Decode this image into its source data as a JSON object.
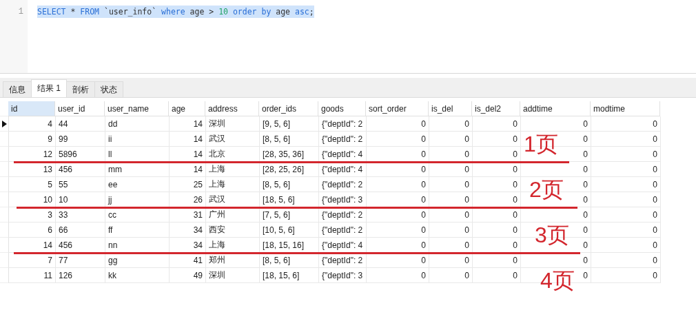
{
  "editor": {
    "lines": [
      {
        "number": "1",
        "selected": true,
        "tokens": [
          {
            "text": "SELECT",
            "kind": "keyword"
          },
          {
            "text": " * ",
            "kind": "plain"
          },
          {
            "text": "FROM",
            "kind": "keyword"
          },
          {
            "text": " `user_info` ",
            "kind": "plain"
          },
          {
            "text": "where",
            "kind": "keyword"
          },
          {
            "text": " age > ",
            "kind": "plain"
          },
          {
            "text": "10",
            "kind": "number"
          },
          {
            "text": " order",
            "kind": "keyword"
          },
          {
            "text": " by",
            "kind": "keyword"
          },
          {
            "text": " age ",
            "kind": "plain"
          },
          {
            "text": "asc",
            "kind": "keyword"
          },
          {
            "text": ";",
            "kind": "plain"
          }
        ]
      }
    ]
  },
  "tabs": [
    {
      "label": "信息",
      "selected": false
    },
    {
      "label": "结果 1",
      "selected": true
    },
    {
      "label": "剖析",
      "selected": false
    },
    {
      "label": "状态",
      "selected": false
    }
  ],
  "table": {
    "columns": [
      {
        "label": "id",
        "kind": "number",
        "selected": true
      },
      {
        "label": "user_id",
        "kind": "text",
        "selected": false
      },
      {
        "label": "user_name",
        "kind": "text",
        "selected": false
      },
      {
        "label": "age",
        "kind": "number",
        "selected": false
      },
      {
        "label": "address",
        "kind": "text",
        "selected": false
      },
      {
        "label": "order_ids",
        "kind": "text",
        "selected": false
      },
      {
        "label": "goods",
        "kind": "text",
        "selected": false
      },
      {
        "label": "sort_order",
        "kind": "number",
        "selected": false
      },
      {
        "label": "is_del",
        "kind": "number",
        "selected": false
      },
      {
        "label": "is_del2",
        "kind": "number",
        "selected": false
      },
      {
        "label": "addtime",
        "kind": "number",
        "selected": false
      },
      {
        "label": "modtime",
        "kind": "number",
        "selected": false
      }
    ],
    "rows": [
      {
        "selected": true,
        "cells": [
          "4",
          "44",
          "dd",
          "14",
          "深圳",
          "[9, 5, 6]",
          "{\"deptId\": 2",
          "0",
          "0",
          "0",
          "0",
          "0"
        ]
      },
      {
        "selected": false,
        "cells": [
          "9",
          "99",
          "ii",
          "14",
          "武汉",
          "[8, 5, 6]",
          "{\"deptId\": 2",
          "0",
          "0",
          "0",
          "0",
          "0"
        ]
      },
      {
        "selected": false,
        "cells": [
          "12",
          "5896",
          "ll",
          "14",
          "北京",
          "[28, 35, 36]",
          "{\"deptId\": 4",
          "0",
          "0",
          "0",
          "0",
          "0"
        ]
      },
      {
        "selected": false,
        "cells": [
          "13",
          "456",
          "mm",
          "14",
          "上海",
          "[28, 25, 26]",
          "{\"deptId\": 4",
          "0",
          "0",
          "0",
          "0",
          "0"
        ]
      },
      {
        "selected": false,
        "cells": [
          "5",
          "55",
          "ee",
          "25",
          "上海",
          "[8, 5, 6]",
          "{\"deptId\": 2",
          "0",
          "0",
          "0",
          "0",
          "0"
        ]
      },
      {
        "selected": false,
        "cells": [
          "10",
          "10",
          "jj",
          "26",
          "武汉",
          "[18, 5, 6]",
          "{\"deptId\": 3",
          "0",
          "0",
          "0",
          "0",
          "0"
        ]
      },
      {
        "selected": false,
        "cells": [
          "3",
          "33",
          "cc",
          "31",
          "广州",
          "[7, 5, 6]",
          "{\"deptId\": 2",
          "0",
          "0",
          "0",
          "0",
          "0"
        ]
      },
      {
        "selected": false,
        "cells": [
          "6",
          "66",
          "ff",
          "34",
          "西安",
          "[10, 5, 6]",
          "{\"deptId\": 2",
          "0",
          "0",
          "0",
          "0",
          "0"
        ]
      },
      {
        "selected": false,
        "cells": [
          "14",
          "456",
          "nn",
          "34",
          "上海",
          "[18, 15, 16]",
          "{\"deptId\": 4",
          "0",
          "0",
          "0",
          "0",
          "0"
        ]
      },
      {
        "selected": false,
        "cells": [
          "7",
          "77",
          "gg",
          "41",
          "郑州",
          "[8, 5, 6]",
          "{\"deptId\": 2",
          "0",
          "0",
          "0",
          "0",
          "0"
        ]
      },
      {
        "selected": false,
        "cells": [
          "11",
          "126",
          "kk",
          "49",
          "深圳",
          "[18, 15, 6]",
          "{\"deptId\": 3",
          "0",
          "0",
          "0",
          "0",
          "0"
        ]
      }
    ]
  },
  "annotations": [
    {
      "label": "1页",
      "divider": true
    },
    {
      "label": "2页",
      "divider": true
    },
    {
      "label": "3页",
      "divider": true
    },
    {
      "label": "4页",
      "divider": false
    }
  ]
}
